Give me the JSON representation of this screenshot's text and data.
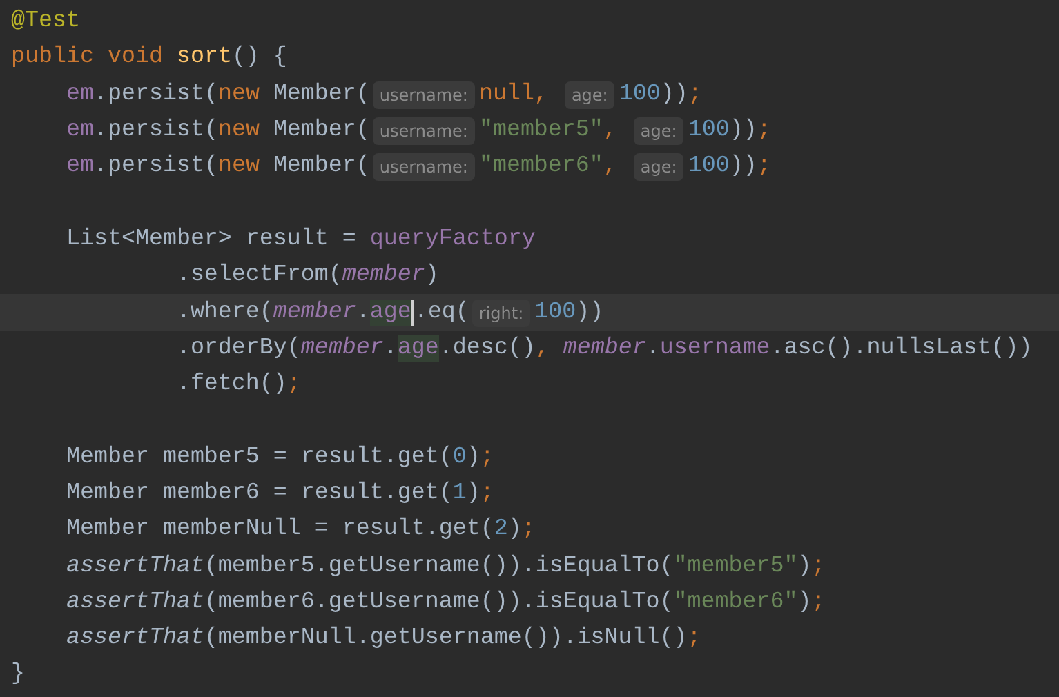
{
  "editor": {
    "lines": [
      {
        "kind": "code",
        "segments": [
          {
            "kind": "code",
            "tokens": [
              {
                "kind": "annotation",
                "text": "@Test"
              }
            ]
          }
        ]
      },
      {
        "kind": "code",
        "segments": [
          {
            "kind": "code",
            "tokens": [
              {
                "kind": "keyword",
                "text": "public void "
              },
              {
                "kind": "method-decl",
                "text": "sort"
              },
              {
                "kind": "plain",
                "text": "() {"
              }
            ]
          }
        ]
      },
      {
        "kind": "code",
        "segments": [
          {
            "kind": "code",
            "tokens": [
              {
                "kind": "field",
                "text": "    em"
              },
              {
                "kind": "plain",
                "text": ".persist("
              },
              {
                "kind": "keyword",
                "text": "new "
              },
              {
                "kind": "plain",
                "text": "Member("
              }
            ]
          },
          {
            "kind": "hint",
            "text": "username:"
          },
          {
            "kind": "code",
            "tokens": [
              {
                "kind": "keyword",
                "text": "null, "
              }
            ]
          },
          {
            "kind": "hint",
            "text": "age:"
          },
          {
            "kind": "code",
            "tokens": [
              {
                "kind": "number",
                "text": "100"
              },
              {
                "kind": "plain",
                "text": "))"
              },
              {
                "kind": "punct",
                "text": ";"
              }
            ]
          }
        ]
      },
      {
        "kind": "code",
        "segments": [
          {
            "kind": "code",
            "tokens": [
              {
                "kind": "field",
                "text": "    em"
              },
              {
                "kind": "plain",
                "text": ".persist("
              },
              {
                "kind": "keyword",
                "text": "new "
              },
              {
                "kind": "plain",
                "text": "Member("
              }
            ]
          },
          {
            "kind": "hint",
            "text": "username:"
          },
          {
            "kind": "code",
            "tokens": [
              {
                "kind": "string",
                "text": "\"member5\""
              },
              {
                "kind": "punct",
                "text": ", "
              }
            ]
          },
          {
            "kind": "hint",
            "text": "age:"
          },
          {
            "kind": "code",
            "tokens": [
              {
                "kind": "number",
                "text": "100"
              },
              {
                "kind": "plain",
                "text": "))"
              },
              {
                "kind": "punct",
                "text": ";"
              }
            ]
          }
        ]
      },
      {
        "kind": "code",
        "segments": [
          {
            "kind": "code",
            "tokens": [
              {
                "kind": "field",
                "text": "    em"
              },
              {
                "kind": "plain",
                "text": ".persist("
              },
              {
                "kind": "keyword",
                "text": "new "
              },
              {
                "kind": "plain",
                "text": "Member("
              }
            ]
          },
          {
            "kind": "hint",
            "text": "username:"
          },
          {
            "kind": "code",
            "tokens": [
              {
                "kind": "string",
                "text": "\"member6\""
              },
              {
                "kind": "punct",
                "text": ", "
              }
            ]
          },
          {
            "kind": "hint",
            "text": "age:"
          },
          {
            "kind": "code",
            "tokens": [
              {
                "kind": "number",
                "text": "100"
              },
              {
                "kind": "plain",
                "text": "))"
              },
              {
                "kind": "punct",
                "text": ";"
              }
            ]
          }
        ]
      },
      {
        "kind": "blank"
      },
      {
        "kind": "code",
        "segments": [
          {
            "kind": "code",
            "tokens": [
              {
                "kind": "plain",
                "text": "    List<Member> result = "
              },
              {
                "kind": "field",
                "text": "queryFactory"
              }
            ]
          }
        ]
      },
      {
        "kind": "code",
        "segments": [
          {
            "kind": "code",
            "tokens": [
              {
                "kind": "plain",
                "text": "            .selectFrom("
              },
              {
                "kind": "field-italic",
                "text": "member"
              },
              {
                "kind": "plain",
                "text": ")"
              }
            ]
          }
        ]
      },
      {
        "kind": "current-line",
        "segments": [
          {
            "kind": "code",
            "tokens": [
              {
                "kind": "plain",
                "text": "            .where("
              },
              {
                "kind": "field-italic",
                "text": "member"
              },
              {
                "kind": "plain",
                "text": "."
              },
              {
                "kind": "match-caret",
                "text": "age"
              },
              {
                "kind": "plain",
                "text": ".eq("
              }
            ]
          },
          {
            "kind": "hint",
            "text": "right:"
          },
          {
            "kind": "code",
            "tokens": [
              {
                "kind": "number",
                "text": "100"
              },
              {
                "kind": "plain",
                "text": "))"
              }
            ]
          }
        ]
      },
      {
        "kind": "code",
        "segments": [
          {
            "kind": "code",
            "tokens": [
              {
                "kind": "plain",
                "text": "            .orderBy("
              },
              {
                "kind": "field-italic",
                "text": "member"
              },
              {
                "kind": "plain",
                "text": "."
              },
              {
                "kind": "match",
                "text": "age"
              },
              {
                "kind": "plain",
                "text": ".desc()"
              },
              {
                "kind": "punct",
                "text": ", "
              },
              {
                "kind": "field-italic",
                "text": "member"
              },
              {
                "kind": "plain",
                "text": "."
              },
              {
                "kind": "field",
                "text": "username"
              },
              {
                "kind": "plain",
                "text": ".asc().nullsLast())"
              }
            ]
          }
        ]
      },
      {
        "kind": "code",
        "segments": [
          {
            "kind": "code",
            "tokens": [
              {
                "kind": "plain",
                "text": "            .fetch()"
              },
              {
                "kind": "punct",
                "text": ";"
              }
            ]
          }
        ]
      },
      {
        "kind": "blank"
      },
      {
        "kind": "code",
        "segments": [
          {
            "kind": "code",
            "tokens": [
              {
                "kind": "plain",
                "text": "    Member member5 = result.get("
              },
              {
                "kind": "number",
                "text": "0"
              },
              {
                "kind": "plain",
                "text": ")"
              },
              {
                "kind": "punct",
                "text": ";"
              }
            ]
          }
        ]
      },
      {
        "kind": "code",
        "segments": [
          {
            "kind": "code",
            "tokens": [
              {
                "kind": "plain",
                "text": "    Member member6 = result.get("
              },
              {
                "kind": "number",
                "text": "1"
              },
              {
                "kind": "plain",
                "text": ")"
              },
              {
                "kind": "punct",
                "text": ";"
              }
            ]
          }
        ]
      },
      {
        "kind": "code",
        "segments": [
          {
            "kind": "code",
            "tokens": [
              {
                "kind": "plain",
                "text": "    Member memberNull = result.get("
              },
              {
                "kind": "number",
                "text": "2"
              },
              {
                "kind": "plain",
                "text": ")"
              },
              {
                "kind": "punct",
                "text": ";"
              }
            ]
          }
        ]
      },
      {
        "kind": "code",
        "segments": [
          {
            "kind": "code",
            "tokens": [
              {
                "kind": "static-italic",
                "text": "    assertThat"
              },
              {
                "kind": "plain",
                "text": "(member5.getUsername()).isEqualTo("
              },
              {
                "kind": "string",
                "text": "\"member5\""
              },
              {
                "kind": "plain",
                "text": ")"
              },
              {
                "kind": "punct",
                "text": ";"
              }
            ]
          }
        ]
      },
      {
        "kind": "code",
        "segments": [
          {
            "kind": "code",
            "tokens": [
              {
                "kind": "static-italic",
                "text": "    assertThat"
              },
              {
                "kind": "plain",
                "text": "(member6.getUsername()).isEqualTo("
              },
              {
                "kind": "string",
                "text": "\"member6\""
              },
              {
                "kind": "plain",
                "text": ")"
              },
              {
                "kind": "punct",
                "text": ";"
              }
            ]
          }
        ]
      },
      {
        "kind": "code",
        "segments": [
          {
            "kind": "code",
            "tokens": [
              {
                "kind": "static-italic",
                "text": "    assertThat"
              },
              {
                "kind": "plain",
                "text": "(memberNull.getUsername()).isNull()"
              },
              {
                "kind": "punct",
                "text": ";"
              }
            ]
          }
        ]
      },
      {
        "kind": "code",
        "segments": [
          {
            "kind": "code",
            "tokens": [
              {
                "kind": "plain",
                "text": "}"
              }
            ]
          }
        ]
      }
    ]
  }
}
